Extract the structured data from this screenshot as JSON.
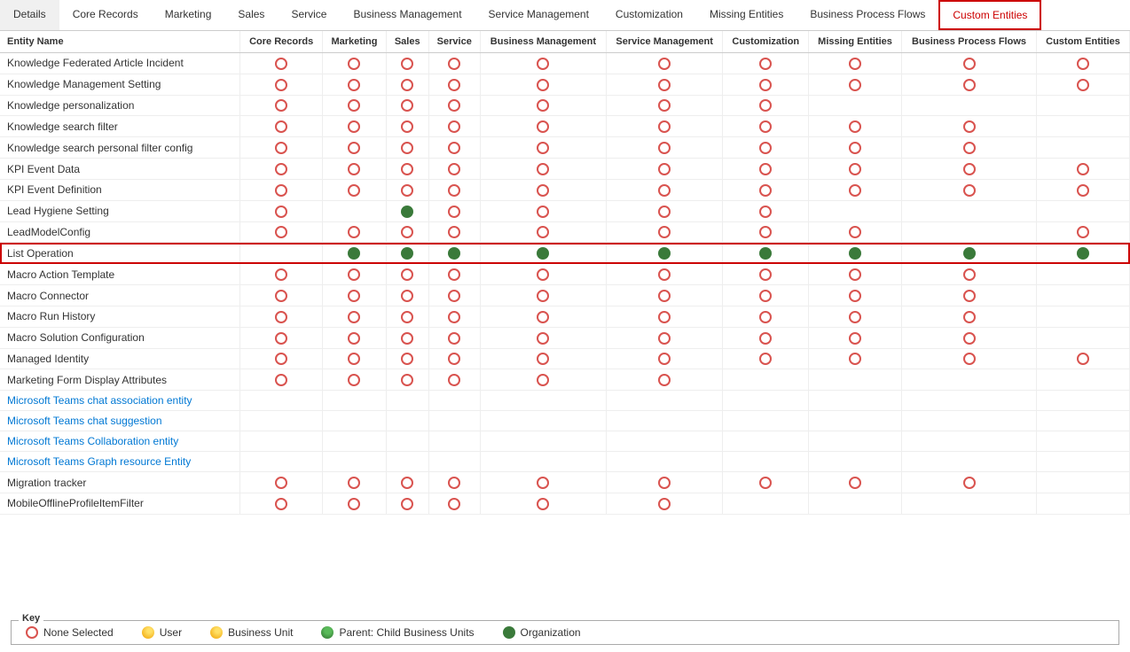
{
  "tabs": [
    {
      "id": "details",
      "label": "Details",
      "active": false
    },
    {
      "id": "core-records",
      "label": "Core Records",
      "active": false
    },
    {
      "id": "marketing",
      "label": "Marketing",
      "active": false
    },
    {
      "id": "sales",
      "label": "Sales",
      "active": false
    },
    {
      "id": "service",
      "label": "Service",
      "active": false
    },
    {
      "id": "business-management",
      "label": "Business Management",
      "active": false
    },
    {
      "id": "service-management",
      "label": "Service Management",
      "active": false
    },
    {
      "id": "customization",
      "label": "Customization",
      "active": false
    },
    {
      "id": "missing-entities",
      "label": "Missing Entities",
      "active": false
    },
    {
      "id": "business-process-flows",
      "label": "Business Process Flows",
      "active": false
    },
    {
      "id": "custom-entities",
      "label": "Custom Entities",
      "active": true
    }
  ],
  "columns": [
    "Entity Name",
    "Core Records",
    "Marketing",
    "Sales",
    "Service",
    "Business Management",
    "Service Management",
    "Customization",
    "Missing Entities",
    "Business Process Flows",
    "Custom Entities"
  ],
  "rows": [
    {
      "name": "Knowledge Federated Article Incident",
      "isLink": false,
      "highlighted": false,
      "cells": [
        "empty",
        "empty",
        "empty",
        "empty",
        "empty",
        "empty",
        "empty",
        "empty",
        "empty",
        "empty"
      ]
    },
    {
      "name": "Knowledge Management Setting",
      "isLink": false,
      "highlighted": false,
      "cells": [
        "empty",
        "empty",
        "empty",
        "empty",
        "empty",
        "empty",
        "empty",
        "empty",
        "empty",
        "empty"
      ]
    },
    {
      "name": "Knowledge personalization",
      "isLink": false,
      "highlighted": false,
      "cells": [
        "empty",
        "empty",
        "empty",
        "empty",
        "empty",
        "empty",
        "empty",
        "",
        "",
        ""
      ]
    },
    {
      "name": "Knowledge search filter",
      "isLink": false,
      "highlighted": false,
      "cells": [
        "empty",
        "empty",
        "empty",
        "empty",
        "empty",
        "empty",
        "empty",
        "empty",
        "empty",
        ""
      ]
    },
    {
      "name": "Knowledge search personal filter config",
      "isLink": false,
      "highlighted": false,
      "cells": [
        "empty",
        "empty",
        "empty",
        "empty",
        "empty",
        "empty",
        "empty",
        "empty",
        "empty",
        ""
      ]
    },
    {
      "name": "KPI Event Data",
      "isLink": false,
      "highlighted": false,
      "cells": [
        "empty",
        "empty",
        "empty",
        "empty",
        "empty",
        "empty",
        "empty",
        "empty",
        "empty",
        "empty"
      ]
    },
    {
      "name": "KPI Event Definition",
      "isLink": false,
      "highlighted": false,
      "cells": [
        "empty",
        "empty",
        "empty",
        "empty",
        "empty",
        "empty",
        "empty",
        "empty",
        "empty",
        "empty"
      ]
    },
    {
      "name": "Lead Hygiene Setting",
      "isLink": false,
      "highlighted": false,
      "cells": [
        "empty",
        "",
        "green",
        "empty",
        "empty",
        "empty",
        "empty",
        "",
        "",
        ""
      ]
    },
    {
      "name": "LeadModelConfig",
      "isLink": false,
      "highlighted": false,
      "cells": [
        "empty",
        "empty",
        "empty",
        "empty",
        "empty",
        "empty",
        "empty",
        "empty",
        "",
        "empty"
      ]
    },
    {
      "name": "List Operation",
      "isLink": false,
      "highlighted": true,
      "cells": [
        "",
        "green",
        "green",
        "green",
        "green",
        "green",
        "green",
        "green",
        "green",
        "green"
      ]
    },
    {
      "name": "Macro Action Template",
      "isLink": false,
      "highlighted": false,
      "cells": [
        "empty",
        "empty",
        "empty",
        "empty",
        "empty",
        "empty",
        "empty",
        "empty",
        "empty",
        ""
      ]
    },
    {
      "name": "Macro Connector",
      "isLink": false,
      "highlighted": false,
      "cells": [
        "empty",
        "empty",
        "empty",
        "empty",
        "empty",
        "empty",
        "empty",
        "empty",
        "empty",
        ""
      ]
    },
    {
      "name": "Macro Run History",
      "isLink": false,
      "highlighted": false,
      "cells": [
        "empty",
        "empty",
        "empty",
        "empty",
        "empty",
        "empty",
        "empty",
        "empty",
        "empty",
        ""
      ]
    },
    {
      "name": "Macro Solution Configuration",
      "isLink": false,
      "highlighted": false,
      "cells": [
        "empty",
        "empty",
        "empty",
        "empty",
        "empty",
        "empty",
        "empty",
        "empty",
        "empty",
        ""
      ]
    },
    {
      "name": "Managed Identity",
      "isLink": false,
      "highlighted": false,
      "cells": [
        "empty",
        "empty",
        "empty",
        "empty",
        "empty",
        "empty",
        "empty",
        "empty",
        "empty",
        "empty"
      ]
    },
    {
      "name": "Marketing Form Display Attributes",
      "isLink": false,
      "highlighted": false,
      "cells": [
        "empty",
        "empty",
        "empty",
        "empty",
        "empty",
        "empty",
        "",
        "",
        "",
        ""
      ]
    },
    {
      "name": "Microsoft Teams chat association entity",
      "isLink": true,
      "highlighted": false,
      "cells": [
        "",
        "",
        "",
        "",
        "",
        "",
        "",
        "",
        "",
        ""
      ]
    },
    {
      "name": "Microsoft Teams chat suggestion",
      "isLink": true,
      "highlighted": false,
      "cells": [
        "",
        "",
        "",
        "",
        "",
        "",
        "",
        "",
        "",
        ""
      ]
    },
    {
      "name": "Microsoft Teams Collaboration entity",
      "isLink": true,
      "highlighted": false,
      "cells": [
        "",
        "",
        "",
        "",
        "",
        "",
        "",
        "",
        "",
        ""
      ]
    },
    {
      "name": "Microsoft Teams Graph resource Entity",
      "isLink": true,
      "highlighted": false,
      "cells": [
        "",
        "",
        "",
        "",
        "",
        "",
        "",
        "",
        "",
        ""
      ]
    },
    {
      "name": "Migration tracker",
      "isLink": false,
      "highlighted": false,
      "cells": [
        "empty",
        "empty",
        "empty",
        "empty",
        "empty",
        "empty",
        "empty",
        "empty",
        "empty",
        ""
      ]
    },
    {
      "name": "MobileOfflineProfileItemFilter",
      "isLink": false,
      "highlighted": false,
      "cells": [
        "empty",
        "empty",
        "empty",
        "empty",
        "empty",
        "empty",
        "",
        "",
        "",
        ""
      ]
    }
  ],
  "key": {
    "title": "Key",
    "items": [
      {
        "id": "none",
        "type": "circle-empty",
        "label": "None Selected"
      },
      {
        "id": "user",
        "type": "circle-yellow",
        "label": "User"
      },
      {
        "id": "business-unit",
        "type": "circle-yellow",
        "label": "Business Unit"
      },
      {
        "id": "parent",
        "type": "circle-parent",
        "label": "Parent: Child Business Units"
      },
      {
        "id": "org",
        "type": "circle-green-full",
        "label": "Organization"
      }
    ]
  }
}
